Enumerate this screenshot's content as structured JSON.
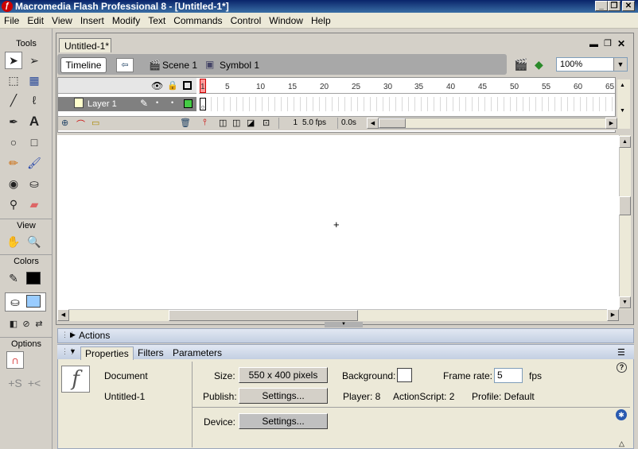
{
  "window": {
    "title": "Macromedia Flash Professional 8 - [Untitled-1*]",
    "minimize": "_",
    "restore": "❐",
    "close": "✕"
  },
  "menu": [
    "File",
    "Edit",
    "View",
    "Insert",
    "Modify",
    "Text",
    "Commands",
    "Control",
    "Window",
    "Help"
  ],
  "tools": {
    "title": "Tools",
    "view_label": "View",
    "colors_label": "Colors",
    "options_label": "Options",
    "stroke_color": "#000000",
    "fill_color": "#99ccff"
  },
  "document": {
    "tab": "Untitled-1*",
    "timeline_button": "Timeline",
    "breadcrumb": [
      "Scene 1",
      "Symbol 1"
    ],
    "zoom": "100%"
  },
  "timeline": {
    "layer_name": "Layer 1",
    "frame_numbers": [
      "1",
      "5",
      "10",
      "15",
      "20",
      "25",
      "30",
      "35",
      "40",
      "45",
      "50",
      "55",
      "60",
      "65"
    ],
    "current_frame": "1",
    "fps": "5.0 fps",
    "elapsed": "0.0s"
  },
  "panels": {
    "actions": "Actions",
    "tabs": [
      "Properties",
      "Filters",
      "Parameters"
    ]
  },
  "properties": {
    "type": "Document",
    "name": "Untitled-1",
    "size_label": "Size:",
    "size_value": "550 x 400 pixels",
    "background_label": "Background:",
    "frame_rate_label": "Frame rate:",
    "frame_rate_value": "5",
    "fps_unit": "fps",
    "publish_label": "Publish:",
    "settings_button": "Settings...",
    "player": "Player: 8",
    "actionscript": "ActionScript: 2",
    "profile": "Profile: Default",
    "device_label": "Device:",
    "device_button": "Settings...",
    "background_color": "#ffffff"
  }
}
